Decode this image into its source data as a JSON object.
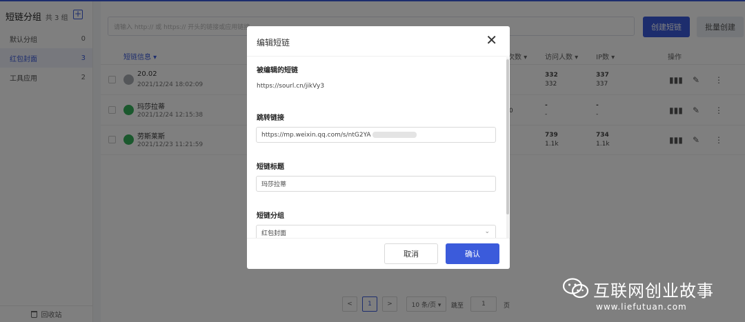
{
  "sidebar": {
    "title": "短链分组",
    "count_label": "共 3 组",
    "add_symbol": "+",
    "items": [
      {
        "label": "默认分组",
        "count": "0"
      },
      {
        "label": "红包封面",
        "count": "3"
      },
      {
        "label": "工具应用",
        "count": "2"
      }
    ],
    "trash_label": "回收站"
  },
  "toolbar": {
    "search_placeholder": "请输入 http:// 或 https:// 开头的链接或应用链接",
    "create_label": "创建短链",
    "batch_label": "批量创建"
  },
  "table": {
    "headers": {
      "info": "短链信息 ▾",
      "clicks": "次数 ▾",
      "visitors": "访问人数 ▾",
      "ip": "IP数 ▾",
      "ops": "操作"
    },
    "rows": [
      {
        "title": "20.02",
        "date": "2021/12/24 18:02:09",
        "icon": "globe-icon",
        "visitors": [
          "332",
          "332"
        ],
        "ip": [
          "337",
          "337"
        ],
        "extra": ""
      },
      {
        "title": "玛莎拉蒂",
        "date": "2021/12/24 12:15:38",
        "icon": "wechat-icon",
        "visitors": [
          "-",
          "-"
        ],
        "ip": [
          "-",
          "-"
        ],
        "extra": "0"
      },
      {
        "title": "劳斯莱斯",
        "date": "2021/12/23 11:21:59",
        "icon": "wechat-icon",
        "visitors": [
          "739",
          "1.1k"
        ],
        "ip": [
          "734",
          "1.1k"
        ],
        "extra": ""
      }
    ]
  },
  "pagination": {
    "prev": "<",
    "current": "1",
    "next": ">",
    "page_size": "10 条/页 ▾",
    "goto_label": "跳至",
    "goto_value": "1",
    "page_suffix": "页"
  },
  "modal": {
    "title": "编辑短链",
    "close_symbol": "✕",
    "edited_label": "被编辑的短链",
    "edited_value": "https://sourl.cn/jikVy3",
    "target_label": "跳转链接",
    "target_value": "https://mp.weixin.qq.com/s/ntG2YA",
    "title_label": "短链标题",
    "title_value": "玛莎拉蒂",
    "group_label": "短链分组",
    "group_value": "红包封面",
    "cancel_label": "取消",
    "ok_label": "确认"
  },
  "watermark": {
    "title": "互联网创业故事",
    "url": "www.liefutuan.com"
  },
  "colors": {
    "accent": "#3b5bdb",
    "wechat": "#34b15a"
  }
}
